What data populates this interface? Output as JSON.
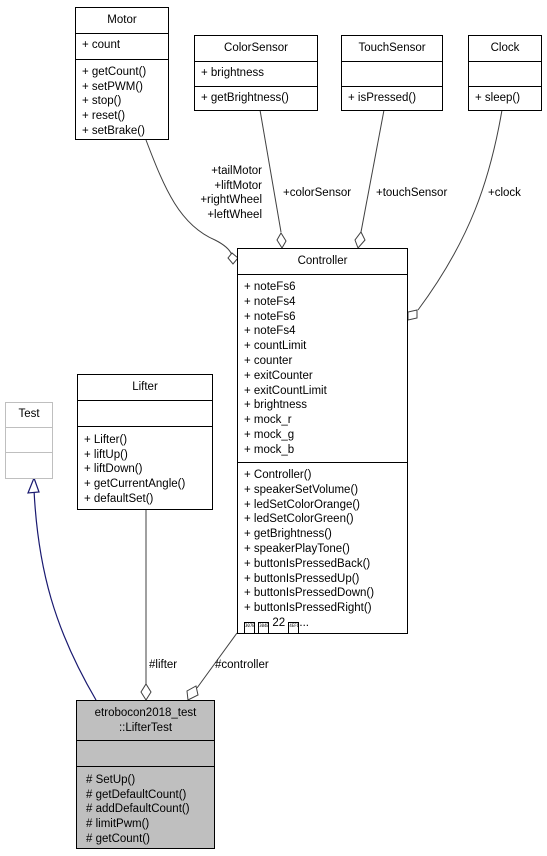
{
  "diagram": {
    "classes": {
      "motor": {
        "name": "Motor",
        "attributes": [
          "+ count"
        ],
        "methods": [
          "+ getCount()",
          "+ setPWM()",
          "+ stop()",
          "+ reset()",
          "+ setBrake()"
        ]
      },
      "color_sensor": {
        "name": "ColorSensor",
        "attributes": [
          "+ brightness"
        ],
        "methods": [
          "+ getBrightness()"
        ]
      },
      "touch_sensor": {
        "name": "TouchSensor",
        "attributes": [],
        "methods": [
          "+ isPressed()"
        ]
      },
      "clock": {
        "name": "Clock",
        "attributes": [],
        "methods": [
          "+ sleep()"
        ]
      },
      "controller": {
        "name": "Controller",
        "attributes": [
          "+ noteFs6",
          "+ noteFs4",
          "+ noteFs6",
          "+ noteFs4",
          "+ countLimit",
          "+ counter",
          "+ exitCounter",
          "+ exitCountLimit",
          "+ brightness",
          "+ mock_r",
          "+ mock_g",
          "+ mock_b"
        ],
        "methods": [
          "+ Controller()",
          "+ speakerSetVolume()",
          "+ ledSetColorOrange()",
          "+ ledSetColorGreen()",
          "+ getBrightness()",
          "+ speakerPlayTone()",
          "+ buttonIsPressedBack()",
          "+ buttonIsPressedUp()",
          "+ buttonIsPressedDown()",
          "+ buttonIsPressedRight()"
        ],
        "more_row": {
          "glyph1": "307B",
          "glyph2": "304B",
          "count": "22",
          "glyph3": "4EF6",
          "ellipsis": "..."
        }
      },
      "test": {
        "name": "Test",
        "attributes": [],
        "methods": []
      },
      "lifter": {
        "name": "Lifter",
        "attributes": [],
        "methods": [
          "+ Lifter()",
          "+ liftUp()",
          "+ liftDown()",
          "+ getCurrentAngle()",
          "+ defaultSet()"
        ]
      },
      "lifter_test": {
        "name_line1": "etrobocon2018_test",
        "name_line2": "::LifterTest",
        "attributes": [],
        "methods": [
          "# SetUp()",
          "# getDefaultCount()",
          "# addDefaultCount()",
          "# limitPwm()",
          "# getCount()"
        ]
      }
    },
    "edge_labels": {
      "motor_roles": [
        "+tailMotor",
        "+liftMotor",
        "+rightWheel",
        "+leftWheel"
      ],
      "color_sensor": "+colorSensor",
      "touch_sensor": "+touchSensor",
      "clock": "+clock",
      "lifter": "#lifter",
      "controller": "#controller"
    },
    "colors": {
      "inheritance_edge": "#191970",
      "aggregation_edge": "#404040",
      "focus_fill": "#bfbfbf",
      "external_border": "#bfbfbf"
    }
  }
}
